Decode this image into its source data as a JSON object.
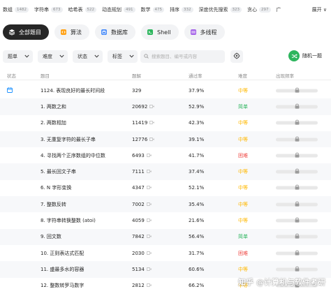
{
  "tag_strip": [
    {
      "name": "数组",
      "count": "1482"
    },
    {
      "name": "字符串",
      "count": "673"
    },
    {
      "name": "哈希表",
      "count": "522"
    },
    {
      "name": "动态规划",
      "count": "491"
    },
    {
      "name": "数学",
      "count": "475"
    },
    {
      "name": "排序",
      "count": "332"
    },
    {
      "name": "深度优先搜索",
      "count": "323"
    },
    {
      "name": "贪心",
      "count": "297"
    },
    {
      "name": "广",
      "count": ""
    }
  ],
  "expand_label": "展开 ∨",
  "categories": [
    {
      "label": "全部题目",
      "icon": "stack-icon",
      "active": true
    },
    {
      "label": "算法",
      "icon": "code-icon",
      "active": false
    },
    {
      "label": "数据库",
      "icon": "database-icon",
      "active": false
    },
    {
      "label": "Shell",
      "icon": "terminal-icon",
      "active": false
    },
    {
      "label": "多线程",
      "icon": "threads-icon",
      "active": false
    }
  ],
  "filters": [
    {
      "label": "题单"
    },
    {
      "label": "难度"
    },
    {
      "label": "状态"
    },
    {
      "label": "标签"
    }
  ],
  "search": {
    "placeholder": "搜索题目、编号或内容"
  },
  "random_label": "随机一题",
  "columns": {
    "status": "状态",
    "title": "题目",
    "solutions": "题解",
    "acceptance": "通过率",
    "difficulty": "难度",
    "frequency": "出现频率"
  },
  "rows": [
    {
      "title": "1124. 表现良好的最长时间段",
      "solutions": "329",
      "video": false,
      "acceptance": "37.9%",
      "difficulty": "中等",
      "level": "mid",
      "daily": true
    },
    {
      "title": "1. 两数之和",
      "solutions": "20692",
      "video": true,
      "acceptance": "52.9%",
      "difficulty": "简单",
      "level": "easy",
      "daily": false
    },
    {
      "title": "2. 两数相加",
      "solutions": "11419",
      "video": true,
      "acceptance": "42.3%",
      "difficulty": "中等",
      "level": "mid",
      "daily": false
    },
    {
      "title": "3. 无重复字符的最长子串",
      "solutions": "12776",
      "video": true,
      "acceptance": "39.1%",
      "difficulty": "中等",
      "level": "mid",
      "daily": false
    },
    {
      "title": "4. 寻找两个正序数组的中位数",
      "solutions": "6493",
      "video": true,
      "acceptance": "41.7%",
      "difficulty": "困难",
      "level": "hard",
      "daily": false
    },
    {
      "title": "5. 最长回文子串",
      "solutions": "7111",
      "video": true,
      "acceptance": "37.4%",
      "difficulty": "中等",
      "level": "mid",
      "daily": false
    },
    {
      "title": "6. N 字形变换",
      "solutions": "4347",
      "video": true,
      "acceptance": "52.1%",
      "difficulty": "中等",
      "level": "mid",
      "daily": false
    },
    {
      "title": "7. 整数反转",
      "solutions": "7002",
      "video": true,
      "acceptance": "35.4%",
      "difficulty": "中等",
      "level": "mid",
      "daily": false
    },
    {
      "title": "8. 字符串转换整数 (atoi)",
      "solutions": "4059",
      "video": true,
      "acceptance": "21.6%",
      "difficulty": "中等",
      "level": "mid",
      "daily": false
    },
    {
      "title": "9. 回文数",
      "solutions": "7842",
      "video": true,
      "acceptance": "56.4%",
      "difficulty": "简单",
      "level": "easy",
      "daily": false
    },
    {
      "title": "10. 正则表达式匹配",
      "solutions": "2030",
      "video": true,
      "acceptance": "31.7%",
      "difficulty": "困难",
      "level": "hard",
      "daily": false
    },
    {
      "title": "11. 盛最多水的容器",
      "solutions": "5134",
      "video": true,
      "acceptance": "60.6%",
      "difficulty": "中等",
      "level": "mid",
      "daily": false
    },
    {
      "title": "12. 整数转罗马数字",
      "solutions": "2812",
      "video": true,
      "acceptance": "66.2%",
      "difficulty": "中等",
      "level": "mid",
      "daily": false
    }
  ],
  "watermark": "知乎 @计算机与软件考研",
  "colors": {
    "easy": "#2db55d",
    "medium": "#ffb800",
    "hard": "#ef4743",
    "accent": "#2db55d",
    "active_pill": "#262626"
  }
}
